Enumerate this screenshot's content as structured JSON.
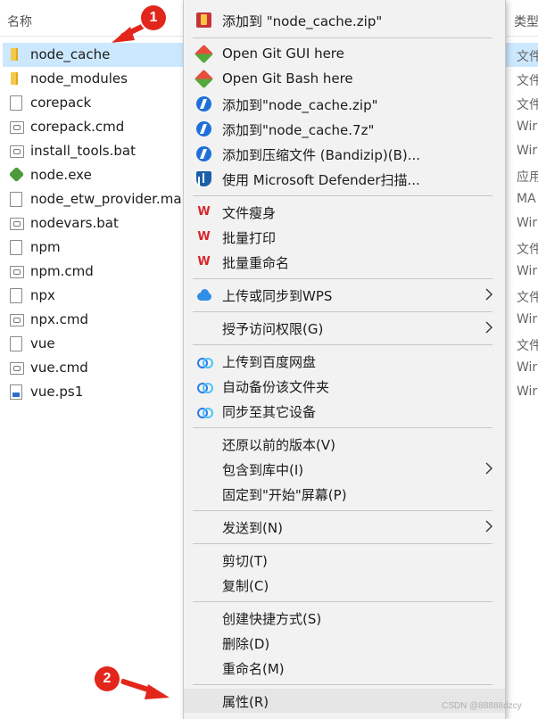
{
  "explorer": {
    "header": {
      "name": "名称",
      "type": "类型"
    },
    "files": [
      {
        "name": "node_cache",
        "type": "文件",
        "icon": "folder-icon",
        "selected": true
      },
      {
        "name": "node_modules",
        "type": "文件",
        "icon": "folder-icon"
      },
      {
        "name": "corepack",
        "type": "文件",
        "icon": "file-icon"
      },
      {
        "name": "corepack.cmd",
        "type": "Wir",
        "icon": "cmd-file-icon"
      },
      {
        "name": "install_tools.bat",
        "type": "Wir",
        "icon": "cmd-file-icon"
      },
      {
        "name": "node.exe",
        "type": "应用",
        "icon": "node-exe-icon"
      },
      {
        "name": "node_etw_provider.man",
        "type": "MA",
        "icon": "file-icon"
      },
      {
        "name": "nodevars.bat",
        "type": "Wir",
        "icon": "cmd-file-icon"
      },
      {
        "name": "npm",
        "type": "文件",
        "icon": "file-icon"
      },
      {
        "name": "npm.cmd",
        "type": "Wir",
        "icon": "cmd-file-icon"
      },
      {
        "name": "npx",
        "type": "文件",
        "icon": "file-icon"
      },
      {
        "name": "npx.cmd",
        "type": "Wir",
        "icon": "cmd-file-icon"
      },
      {
        "name": "vue",
        "type": "文件",
        "icon": "file-icon"
      },
      {
        "name": "vue.cmd",
        "type": "Wir",
        "icon": "cmd-file-icon"
      },
      {
        "name": "vue.ps1",
        "type": "Wir",
        "icon": "ps1-file-icon"
      }
    ]
  },
  "menu": {
    "items": [
      {
        "label": "添加到 \"node_cache.zip\"",
        "icon": "winrar-icon"
      },
      {
        "label": "Open Git GUI here",
        "icon": "git-icon"
      },
      {
        "label": "Open Git Bash here",
        "icon": "git-icon"
      },
      {
        "label": "添加到\"node_cache.zip\"",
        "icon": "bandizip-icon"
      },
      {
        "label": "添加到\"node_cache.7z\"",
        "icon": "bandizip-icon"
      },
      {
        "label": "添加到压缩文件 (Bandizip)(B)...",
        "icon": "bandizip-icon"
      },
      {
        "label": "使用 Microsoft Defender扫描...",
        "icon": "defender-shield-icon"
      },
      {
        "label": "文件瘦身",
        "icon": "wps-icon"
      },
      {
        "label": "批量打印",
        "icon": "wps-icon"
      },
      {
        "label": "批量重命名",
        "icon": "wps-icon"
      },
      {
        "label": "上传或同步到WPS",
        "icon": "wps-cloud-icon",
        "submenu": true
      },
      {
        "label": "授予访问权限(G)",
        "submenu": true
      },
      {
        "label": "上传到百度网盘",
        "icon": "baidu-netdisk-icon"
      },
      {
        "label": "自动备份该文件夹",
        "icon": "baidu-netdisk-icon"
      },
      {
        "label": "同步至其它设备",
        "icon": "baidu-netdisk-icon"
      },
      {
        "label": "还原以前的版本(V)"
      },
      {
        "label": "包含到库中(I)",
        "submenu": true
      },
      {
        "label": "固定到\"开始\"屏幕(P)"
      },
      {
        "label": "发送到(N)",
        "submenu": true
      },
      {
        "label": "剪切(T)"
      },
      {
        "label": "复制(C)"
      },
      {
        "label": "创建快捷方式(S)"
      },
      {
        "label": "删除(D)"
      },
      {
        "label": "重命名(M)"
      },
      {
        "label": "属性(R)",
        "highlighted": true
      }
    ]
  },
  "annotations": {
    "step1": "1",
    "step2": "2",
    "accent": "#e3261b"
  },
  "watermark": "CSDN @88888dzcy"
}
